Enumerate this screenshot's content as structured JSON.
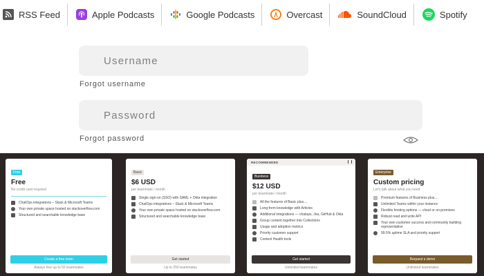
{
  "podcasts": [
    {
      "label": "RSS Feed",
      "icon": "rss-icon",
      "color": "#555555"
    },
    {
      "label": "Apple Podcasts",
      "icon": "apple-podcasts-icon",
      "color": "#9b3fe0"
    },
    {
      "label": "Google Podcasts",
      "icon": "google-podcasts-icon",
      "color": "#4285f4"
    },
    {
      "label": "Overcast",
      "icon": "overcast-icon",
      "color": "#fc7e0f"
    },
    {
      "label": "SoundCloud",
      "icon": "soundcloud-icon",
      "color": "#ff5500"
    },
    {
      "label": "Spotify",
      "icon": "spotify-icon",
      "color": "#1ed760"
    }
  ],
  "login": {
    "username_placeholder": "Username",
    "forgot_username": "Forgot username",
    "password_placeholder": "Password",
    "forgot_password": "Forgot password"
  },
  "pricing": {
    "plans": [
      {
        "badge": "Free",
        "price": "Free",
        "subtitle": "No credit card required",
        "features": [
          "ChatOps integrations – Slack & Microsoft Teams",
          "Your own private space hosted on stackoverflow.com",
          "Structured and searchable knowledge base"
        ],
        "cta": "Create a free team",
        "footnote": "Always free up to 50 teammates"
      },
      {
        "badge": "Basic",
        "price": "$6 USD",
        "subtitle": "per teammate / month",
        "features": [
          "Single sign-on (SSO) with SAML + Okta integration",
          "ChatOps integrations – Slack & Microsoft Teams",
          "Your own private space hosted on stackoverflow.com",
          "Structured and searchable knowledge base"
        ],
        "cta": "Get started",
        "footnote": "Up to 250 teammates"
      },
      {
        "ribbon": "RECOMMENDED",
        "badge": "Business",
        "price": "$12 USD",
        "subtitle": "per teammate / month",
        "features": [
          "All the features of Basic plus....",
          "Long-form knowledge with Articles",
          "Additional integrations — chatops, Jira, GitHub & Okta",
          "Group content together into Collections",
          "Usage and adoption metrics",
          "Priority customer support",
          "Content Health tools"
        ],
        "cta": "Get started",
        "footnote": "Unlimited teammates"
      },
      {
        "badge": "Enterprise",
        "price": "Custom pricing",
        "subtitle": "Let's talk about what you need",
        "features": [
          "Premium features of Business plus....",
          "Unlimited Teams within your instance",
          "Flexible hosting options — cloud or on-premises",
          "Robust read and write API",
          "Your own customer success and community building representative",
          "99.5% uptime SLA and priority support"
        ],
        "cta": "Request a demo",
        "footnote": "Unlimited teammates"
      }
    ]
  },
  "colors": {
    "free_accent": "#2fd0e6",
    "basic_button": "#e8e4e1",
    "business_button": "#3a3533",
    "enterprise_button": "#7a5b2b",
    "enterprise_badge": "#7a5b2b",
    "dark_background": "#2b2624"
  }
}
